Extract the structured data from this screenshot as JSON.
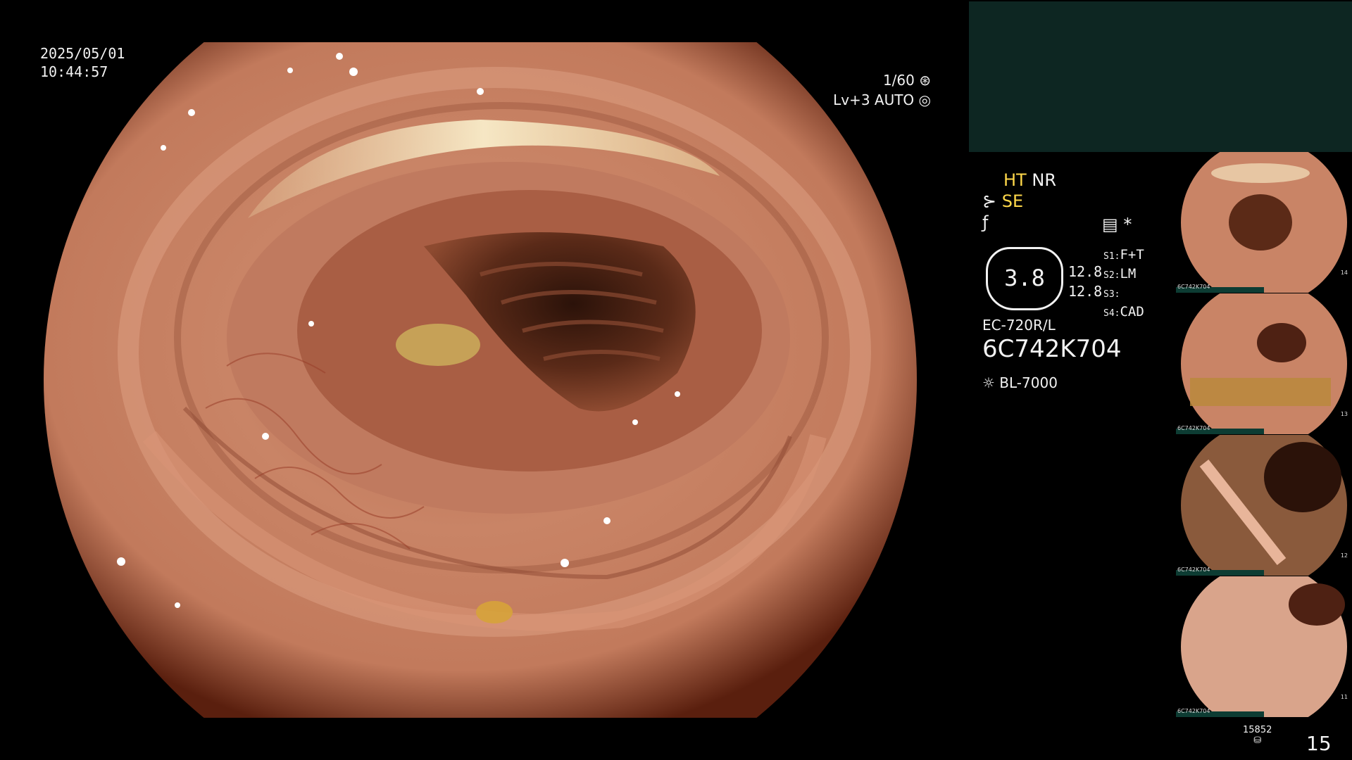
{
  "timestamp": {
    "date": "2025/05/01",
    "time": "10:44:57"
  },
  "shutter": {
    "speed": "1/60",
    "level": "Lv+3 AUTO"
  },
  "modes": {
    "ht": "HT",
    "nr": "NR",
    "se": "SE",
    "asterisk": "*"
  },
  "gauge": {
    "value": "3.8",
    "left_top": "12.8",
    "left_bottom": "12.8"
  },
  "switches": [
    {
      "key": "S1:",
      "value": "F+T"
    },
    {
      "key": "S2:",
      "value": "LM"
    },
    {
      "key": "S3:",
      "value": ""
    },
    {
      "key": "S4:",
      "value": "CAD"
    }
  ],
  "scope": {
    "model": "EC-720R/L",
    "serial": "6C742K704"
  },
  "light_source": "BL-7000",
  "counter": {
    "small": "15852",
    "images": "15"
  },
  "thumbnails": [
    {
      "label": "6C742K704",
      "index": "14"
    },
    {
      "label": "6C742K704",
      "index": "13"
    },
    {
      "label": "6C742K704",
      "index": "12"
    },
    {
      "label": "6C742K704",
      "index": "11"
    }
  ]
}
